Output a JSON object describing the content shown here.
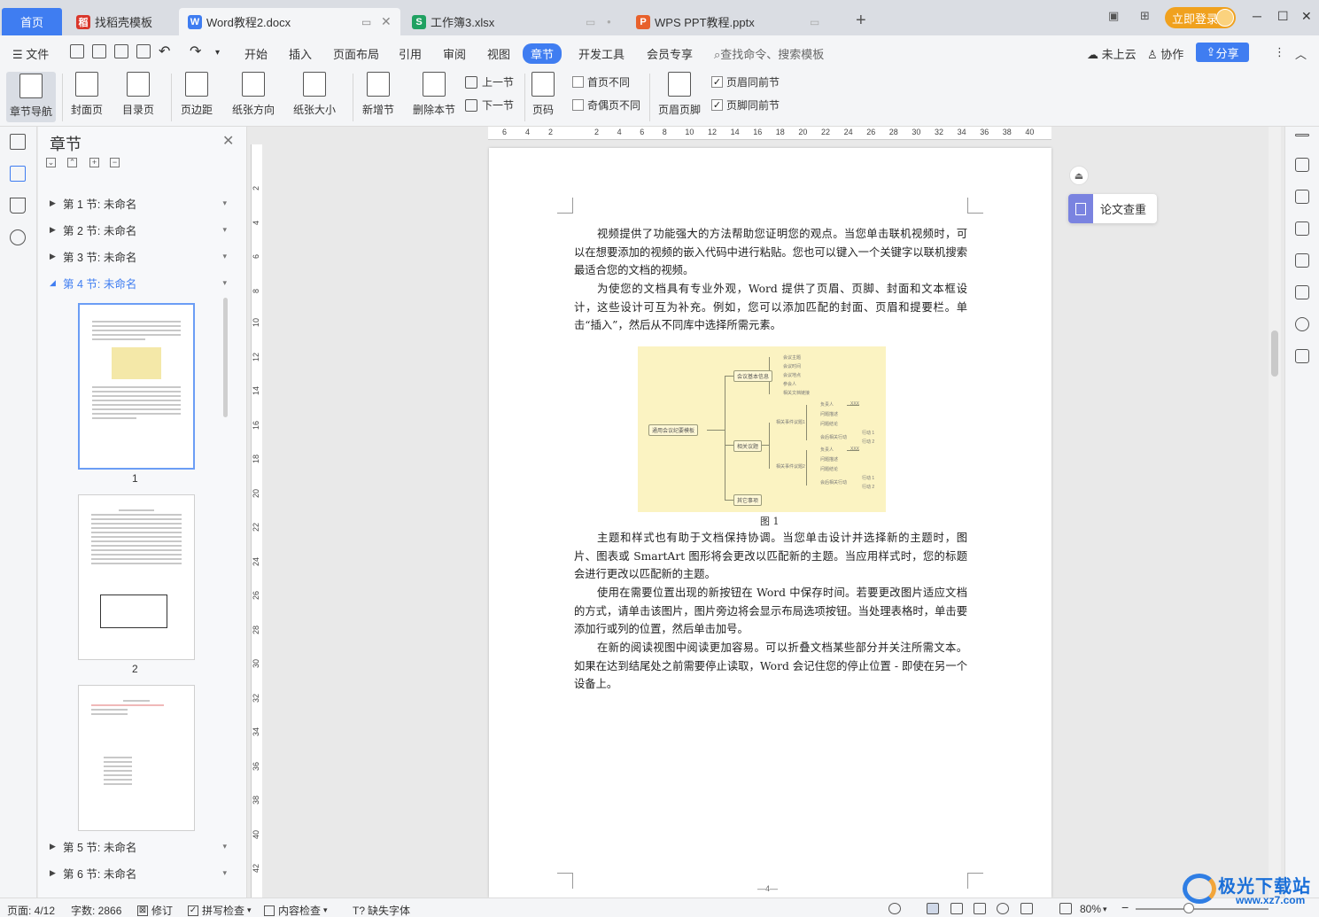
{
  "tabs": {
    "home": "首页",
    "items": [
      {
        "label": "找稻壳模板",
        "icon_char": "稻",
        "color": "#d9362b"
      },
      {
        "label": "Word教程2.docx",
        "icon_char": "W",
        "color": "#3f7df1"
      },
      {
        "label": "工作簿3.xlsx",
        "icon_char": "S",
        "color": "#20a162"
      },
      {
        "label": "WPS PPT教程.pptx",
        "icon_char": "P",
        "color": "#e8612c"
      }
    ],
    "add": "+",
    "login": "立即登录"
  },
  "menubar": {
    "file": "文件",
    "items": [
      "开始",
      "插入",
      "页面布局",
      "引用",
      "审阅",
      "视图",
      "章节",
      "开发工具",
      "会员专享"
    ],
    "search": "查找命令、搜索模板",
    "cloud": "未上云",
    "collab": "协作",
    "share": "分享"
  },
  "ribbon": {
    "nav": "章节导航",
    "cover": "封面页",
    "toc": "目录页",
    "margin": "页边距",
    "orientation": "纸张方向",
    "size": "纸张大小",
    "new_section": "新增节",
    "delete_section": "删除本节",
    "prev_section": "上一节",
    "next_section": "下一节",
    "page_number": "页码",
    "diff_first": "首页不同",
    "diff_odd_even": "奇偶页不同",
    "header_footer": "页眉页脚",
    "header_same": "页眉同前节",
    "footer_same": "页脚同前节"
  },
  "panel": {
    "title": "章节",
    "sections": [
      "第 1 节: 未命名",
      "第 2 节: 未命名",
      "第 3 节: 未命名",
      "第 4 节: 未命名",
      "第 5 节: 未命名",
      "第 6 节: 未命名"
    ],
    "thumb_nums": [
      "1",
      "2"
    ]
  },
  "ruler": {
    "h": [
      "6",
      "4",
      "2",
      "2",
      "4",
      "6",
      "8",
      "10",
      "12",
      "14",
      "16",
      "18",
      "20",
      "22",
      "24",
      "26",
      "28",
      "30",
      "32",
      "34",
      "36",
      "38",
      "40"
    ],
    "v": [
      "2",
      "4",
      "6",
      "8",
      "10",
      "12",
      "14",
      "16",
      "18",
      "20",
      "22",
      "24",
      "26",
      "28",
      "30",
      "32",
      "34",
      "36",
      "38",
      "40",
      "42",
      "44"
    ]
  },
  "document": {
    "p1": "视频提供了功能强大的方法帮助您证明您的观点。当您单击联机视频时，可以在想要添加的视频的嵌入代码中进行粘贴。您也可以键入一个关键字以联机搜索最适合您的文档的视频。",
    "p2": "为使您的文档具有专业外观，Word 提供了页眉、页脚、封面和文本框设计，这些设计可互为补充。例如，您可以添加匹配的封面、页眉和提要栏。单击“插入”，然后从不同库中选择所需元素。",
    "figure_caption": "图 1",
    "p3": "主题和样式也有助于文档保持协调。当您单击设计并选择新的主题时，图片、图表或 SmartArt 图形将会更改以匹配新的主题。当应用样式时，您的标题会进行更改以匹配新的主题。",
    "p4": "使用在需要位置出现的新按钮在 Word 中保存时间。若要更改图片适应文档的方式，请单击该图片，图片旁边将会显示布局选项按钮。当处理表格时，单击要添加行或列的位置，然后单击加号。",
    "p5": "在新的阅读视图中阅读更加容易。可以折叠文档某些部分并关注所需文本。如果在达到结尾处之前需要停止读取，Word 会记住您的停止位置 - 即使在另一个设备上。",
    "footer": "—4—",
    "mindmap": {
      "root": "通用会议纪要模板",
      "branches": [
        "会议基本信息",
        "相关议题",
        "其它事项"
      ],
      "leaves1": [
        "会议主题",
        "会议时间",
        "会议地点",
        "参会人",
        "相关文档链接"
      ],
      "topics": [
        "相关事件议题1",
        "相关事件议题2"
      ],
      "sub": [
        "负责人",
        "问题描述",
        "问题结论",
        "会后相关行动"
      ],
      "xxx": "XXX",
      "actions": [
        "行动 1",
        "行动 2"
      ]
    }
  },
  "floating": {
    "paper_check": "论文查重"
  },
  "statusbar": {
    "page": "页面: 4/12",
    "words": "字数: 2866",
    "revise": "修订",
    "spell": "拼写检查",
    "content": "内容检查",
    "missing_font": "缺失字体",
    "zoom": "80%"
  },
  "watermark": {
    "name": "极光下载站",
    "url": "www.xz7.com"
  }
}
